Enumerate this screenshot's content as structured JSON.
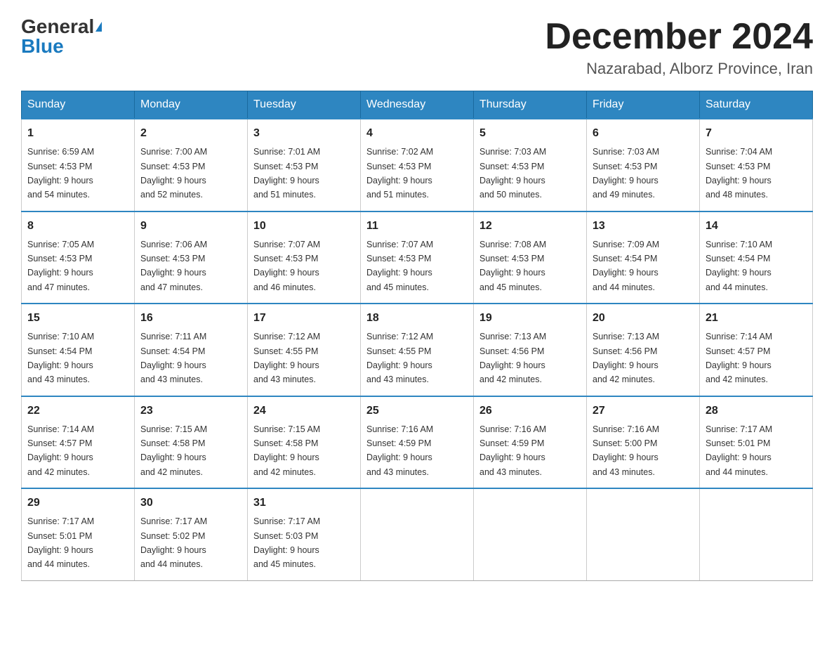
{
  "header": {
    "logo_general": "General",
    "logo_blue": "Blue",
    "month": "December 2024",
    "location": "Nazarabad, Alborz Province, Iran"
  },
  "days_of_week": [
    "Sunday",
    "Monday",
    "Tuesday",
    "Wednesday",
    "Thursday",
    "Friday",
    "Saturday"
  ],
  "weeks": [
    [
      {
        "day": "1",
        "sunrise": "6:59 AM",
        "sunset": "4:53 PM",
        "daylight": "9 hours and 54 minutes."
      },
      {
        "day": "2",
        "sunrise": "7:00 AM",
        "sunset": "4:53 PM",
        "daylight": "9 hours and 52 minutes."
      },
      {
        "day": "3",
        "sunrise": "7:01 AM",
        "sunset": "4:53 PM",
        "daylight": "9 hours and 51 minutes."
      },
      {
        "day": "4",
        "sunrise": "7:02 AM",
        "sunset": "4:53 PM",
        "daylight": "9 hours and 51 minutes."
      },
      {
        "day": "5",
        "sunrise": "7:03 AM",
        "sunset": "4:53 PM",
        "daylight": "9 hours and 50 minutes."
      },
      {
        "day": "6",
        "sunrise": "7:03 AM",
        "sunset": "4:53 PM",
        "daylight": "9 hours and 49 minutes."
      },
      {
        "day": "7",
        "sunrise": "7:04 AM",
        "sunset": "4:53 PM",
        "daylight": "9 hours and 48 minutes."
      }
    ],
    [
      {
        "day": "8",
        "sunrise": "7:05 AM",
        "sunset": "4:53 PM",
        "daylight": "9 hours and 47 minutes."
      },
      {
        "day": "9",
        "sunrise": "7:06 AM",
        "sunset": "4:53 PM",
        "daylight": "9 hours and 47 minutes."
      },
      {
        "day": "10",
        "sunrise": "7:07 AM",
        "sunset": "4:53 PM",
        "daylight": "9 hours and 46 minutes."
      },
      {
        "day": "11",
        "sunrise": "7:07 AM",
        "sunset": "4:53 PM",
        "daylight": "9 hours and 45 minutes."
      },
      {
        "day": "12",
        "sunrise": "7:08 AM",
        "sunset": "4:53 PM",
        "daylight": "9 hours and 45 minutes."
      },
      {
        "day": "13",
        "sunrise": "7:09 AM",
        "sunset": "4:54 PM",
        "daylight": "9 hours and 44 minutes."
      },
      {
        "day": "14",
        "sunrise": "7:10 AM",
        "sunset": "4:54 PM",
        "daylight": "9 hours and 44 minutes."
      }
    ],
    [
      {
        "day": "15",
        "sunrise": "7:10 AM",
        "sunset": "4:54 PM",
        "daylight": "9 hours and 43 minutes."
      },
      {
        "day": "16",
        "sunrise": "7:11 AM",
        "sunset": "4:54 PM",
        "daylight": "9 hours and 43 minutes."
      },
      {
        "day": "17",
        "sunrise": "7:12 AM",
        "sunset": "4:55 PM",
        "daylight": "9 hours and 43 minutes."
      },
      {
        "day": "18",
        "sunrise": "7:12 AM",
        "sunset": "4:55 PM",
        "daylight": "9 hours and 43 minutes."
      },
      {
        "day": "19",
        "sunrise": "7:13 AM",
        "sunset": "4:56 PM",
        "daylight": "9 hours and 42 minutes."
      },
      {
        "day": "20",
        "sunrise": "7:13 AM",
        "sunset": "4:56 PM",
        "daylight": "9 hours and 42 minutes."
      },
      {
        "day": "21",
        "sunrise": "7:14 AM",
        "sunset": "4:57 PM",
        "daylight": "9 hours and 42 minutes."
      }
    ],
    [
      {
        "day": "22",
        "sunrise": "7:14 AM",
        "sunset": "4:57 PM",
        "daylight": "9 hours and 42 minutes."
      },
      {
        "day": "23",
        "sunrise": "7:15 AM",
        "sunset": "4:58 PM",
        "daylight": "9 hours and 42 minutes."
      },
      {
        "day": "24",
        "sunrise": "7:15 AM",
        "sunset": "4:58 PM",
        "daylight": "9 hours and 42 minutes."
      },
      {
        "day": "25",
        "sunrise": "7:16 AM",
        "sunset": "4:59 PM",
        "daylight": "9 hours and 43 minutes."
      },
      {
        "day": "26",
        "sunrise": "7:16 AM",
        "sunset": "4:59 PM",
        "daylight": "9 hours and 43 minutes."
      },
      {
        "day": "27",
        "sunrise": "7:16 AM",
        "sunset": "5:00 PM",
        "daylight": "9 hours and 43 minutes."
      },
      {
        "day": "28",
        "sunrise": "7:17 AM",
        "sunset": "5:01 PM",
        "daylight": "9 hours and 44 minutes."
      }
    ],
    [
      {
        "day": "29",
        "sunrise": "7:17 AM",
        "sunset": "5:01 PM",
        "daylight": "9 hours and 44 minutes."
      },
      {
        "day": "30",
        "sunrise": "7:17 AM",
        "sunset": "5:02 PM",
        "daylight": "9 hours and 44 minutes."
      },
      {
        "day": "31",
        "sunrise": "7:17 AM",
        "sunset": "5:03 PM",
        "daylight": "9 hours and 45 minutes."
      },
      null,
      null,
      null,
      null
    ]
  ],
  "labels": {
    "sunrise": "Sunrise:",
    "sunset": "Sunset:",
    "daylight": "Daylight:"
  }
}
